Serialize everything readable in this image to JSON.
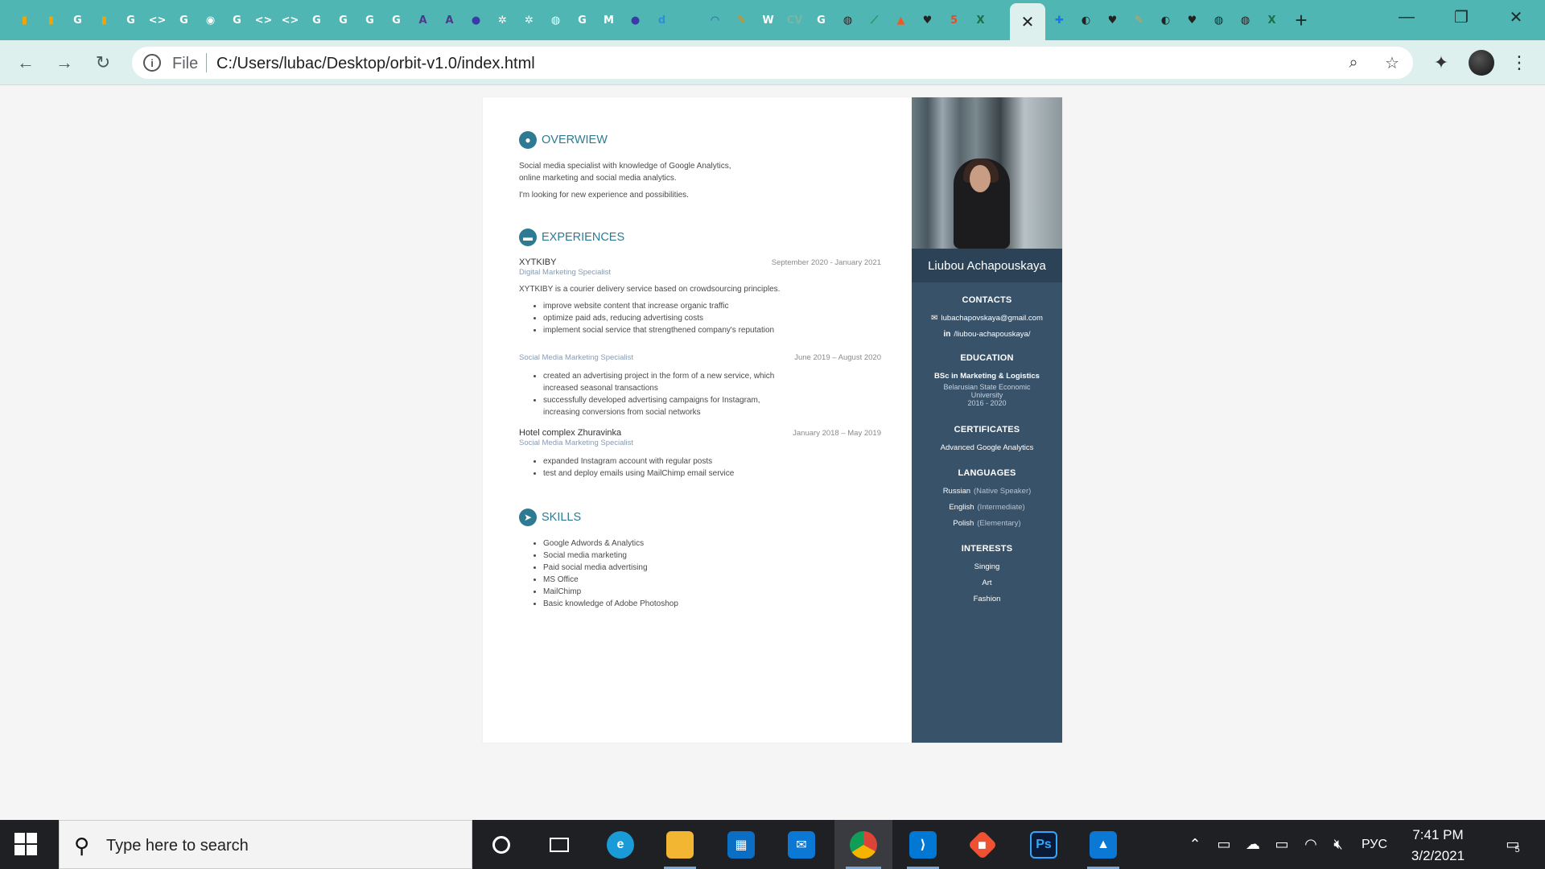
{
  "browser": {
    "tab_favicons": [
      {
        "icon": "analytics-icon",
        "glyph": "▮",
        "color": "#f4a300"
      },
      {
        "icon": "analytics-icon",
        "glyph": "▮",
        "color": "#f4a300"
      },
      {
        "icon": "google-icon",
        "glyph": "G",
        "color": "#ffffff"
      },
      {
        "icon": "analytics-icon",
        "glyph": "▮",
        "color": "#f4a300"
      },
      {
        "icon": "google-icon",
        "glyph": "G",
        "color": "#ffffff"
      },
      {
        "icon": "code-icon",
        "glyph": "<>",
        "color": "#ffffff"
      },
      {
        "icon": "google-icon",
        "glyph": "G",
        "color": "#ffffff"
      },
      {
        "icon": "chrome-icon",
        "glyph": "◉",
        "color": "#ffffff"
      },
      {
        "icon": "google-icon",
        "glyph": "G",
        "color": "#ffffff"
      },
      {
        "icon": "code-icon",
        "glyph": "<>",
        "color": "#ffffff"
      },
      {
        "icon": "code-icon",
        "glyph": "<>",
        "color": "#ffffff"
      },
      {
        "icon": "google-icon",
        "glyph": "G",
        "color": "#ffffff"
      },
      {
        "icon": "google-icon",
        "glyph": "G",
        "color": "#ffffff"
      },
      {
        "icon": "google-icon",
        "glyph": "G",
        "color": "#ffffff"
      },
      {
        "icon": "google-icon",
        "glyph": "G",
        "color": "#ffffff"
      },
      {
        "icon": "a-letter-icon",
        "glyph": "A",
        "color": "#4a3a8c"
      },
      {
        "icon": "a-letter-icon",
        "glyph": "A",
        "color": "#4a3a8c"
      },
      {
        "icon": "circle-icon",
        "glyph": "●",
        "color": "#3a3aa8"
      },
      {
        "icon": "openai-icon",
        "glyph": "✲",
        "color": "#ffffff"
      },
      {
        "icon": "openai-icon",
        "glyph": "✲",
        "color": "#ffffff"
      },
      {
        "icon": "globe-icon",
        "glyph": "◍",
        "color": "#ffffff"
      },
      {
        "icon": "google-icon",
        "glyph": "G",
        "color": "#ffffff"
      },
      {
        "icon": "gmail-icon",
        "glyph": "M",
        "color": "#ffffff"
      },
      {
        "icon": "circle-icon",
        "glyph": "●",
        "color": "#3a3aa8"
      },
      {
        "icon": "d-letter-icon",
        "glyph": "d",
        "color": "#2d8fd6"
      },
      {
        "icon": "n-letter-icon",
        "glyph": "N",
        "color": "#4fb6b3"
      },
      {
        "icon": "wave-icon",
        "glyph": "◠",
        "color": "#2a5fb0"
      },
      {
        "icon": "pen-icon",
        "glyph": "✎",
        "color": "#f08a00"
      },
      {
        "icon": "wikipedia-icon",
        "glyph": "W",
        "color": "#ffffff"
      },
      {
        "icon": "cv-icon",
        "glyph": "CV",
        "color": "#7ab6a5"
      },
      {
        "icon": "google-icon",
        "glyph": "G",
        "color": "#ffffff"
      },
      {
        "icon": "globe-icon",
        "glyph": "◍",
        "color": "#222222"
      },
      {
        "icon": "leaf-icon",
        "glyph": "⟋",
        "color": "#2e8b57"
      },
      {
        "icon": "flame-icon",
        "glyph": "▲",
        "color": "#f05a22"
      },
      {
        "icon": "heart-icon",
        "glyph": "♥",
        "color": "#222222"
      },
      {
        "icon": "html5-icon",
        "glyph": "5",
        "color": "#e34f26"
      },
      {
        "icon": "excel-icon",
        "glyph": "X",
        "color": "#1d6f42"
      }
    ],
    "tab_favicons_after": [
      {
        "icon": "plus-square-icon",
        "glyph": "✚",
        "color": "#1a73e8"
      },
      {
        "icon": "github-icon",
        "glyph": "◐",
        "color": "#222222"
      },
      {
        "icon": "heart-icon",
        "glyph": "♥",
        "color": "#222222"
      },
      {
        "icon": "pen-icon",
        "glyph": "✎",
        "color": "#c9a35a"
      },
      {
        "icon": "github-icon",
        "glyph": "◐",
        "color": "#222222"
      },
      {
        "icon": "heart-icon",
        "glyph": "♥",
        "color": "#222222"
      },
      {
        "icon": "globe-icon",
        "glyph": "◍",
        "color": "#222222"
      },
      {
        "icon": "globe-icon",
        "glyph": "◍",
        "color": "#222222"
      },
      {
        "icon": "excel-icon",
        "glyph": "X",
        "color": "#1d6f42"
      }
    ],
    "active_tab_close": "✕",
    "new_tab": "+",
    "window_controls": {
      "minimize": "—",
      "restore": "❐",
      "close": "✕"
    },
    "nav": {
      "back": "←",
      "forward": "→",
      "reload": "↻"
    },
    "omnibox": {
      "info": "i",
      "scheme_label": "File",
      "url": "C:/Users/lubac/Desktop/orbit-v1.0/index.html",
      "zoom_icon": "⌕",
      "star_icon": "☆"
    },
    "extensions_icon": "✦",
    "menu_icon": "⋮"
  },
  "resume": {
    "overview": {
      "title": "OVERWIEW",
      "lines": [
        "Social media specialist with knowledge of Google Analytics,",
        "online marketing and social media analytics."
      ],
      "extra": "I'm looking for new experience and possibilities."
    },
    "experiences": {
      "title": "EXPERIENCES",
      "jobs": [
        {
          "company": "XYTKIBY",
          "dates": "September 2020 - January 2021",
          "role": "Digital Marketing Specialist",
          "desc": "XYTKIBY is a courier delivery service based on crowdsourcing principles.",
          "bullets": [
            "improve website content that increase organic traffic",
            "optimize paid ads, reducing advertising costs",
            "implement social service that strengthened company's reputation"
          ]
        },
        {
          "company": "",
          "dates": "June 2019 – August 2020",
          "role": "Social Media Marketing Specialist",
          "bullets": [
            "created an advertising project in the form of a new service, which increased seasonal transactions",
            "successfully developed advertising campaigns for Instagram, increasing conversions from social networks"
          ]
        },
        {
          "company": "Hotel complex Zhuravinka",
          "dates": "January 2018 – May 2019",
          "role": "Social Media Marketing Specialist",
          "bullets": [
            "expanded Instagram account with regular posts",
            "test and deploy emails using MailChimp email service"
          ]
        }
      ]
    },
    "skills": {
      "title": "SKILLS",
      "items": [
        "Google Adwords & Analytics",
        "Social media marketing",
        "Paid social media advertising",
        "MS Office",
        "MailChimp",
        "Basic knowledge of Adobe Photoshop"
      ]
    }
  },
  "sidebar": {
    "name": "Liubou Achapouskaya",
    "contacts_title": "CONTACTS",
    "email": "lubachapovskaya@gmail.com",
    "linkedin": "/liubou-achapouskaya/",
    "linkedin_icon_text": "in",
    "education_title": "EDUCATION",
    "degree": "BSc in Marketing & Logistics",
    "university_1": "Belarusian State Economic",
    "university_2": "University",
    "years": "2016 - 2020",
    "certificates_title": "CERTIFICATES",
    "certificate": "Advanced Google Analytics",
    "languages_title": "LANGUAGES",
    "languages": [
      {
        "name": "Russian",
        "level": "(Native Speaker)"
      },
      {
        "name": "English",
        "level": "(Intermediate)"
      },
      {
        "name": "Polish",
        "level": "(Elementary)"
      }
    ],
    "interests_title": "INTERESTS",
    "interests": [
      "Singing",
      "Art",
      "Fashion"
    ]
  },
  "taskbar": {
    "search_placeholder": "Type here to search",
    "language": "РУС",
    "time": "7:41 PM",
    "date": "3/2/2021",
    "notification_count": "5"
  }
}
